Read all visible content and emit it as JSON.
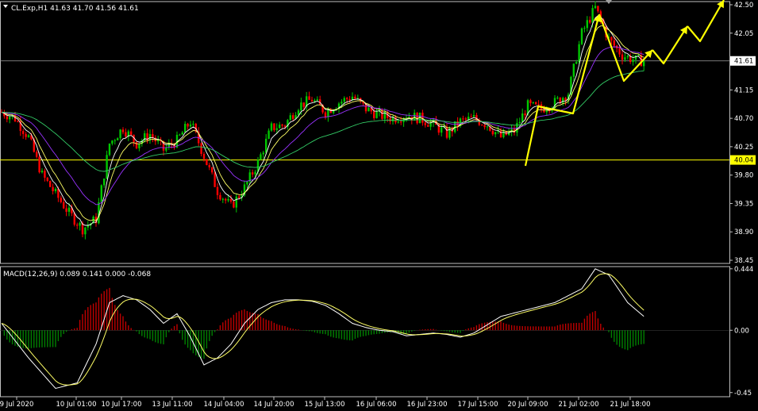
{
  "window": {
    "symbol_header": "CL.Exp,H1  41.63 41.70 41.56 41.61"
  },
  "price_panel": {
    "axis_ticks": [
      "42.50",
      "42.05",
      "41.61",
      "41.15",
      "40.70",
      "40.25",
      "40.04",
      "39.80",
      "39.35",
      "38.90",
      "38.45"
    ],
    "tick_values": [
      42.5,
      42.05,
      41.61,
      41.15,
      40.7,
      40.25,
      40.04,
      39.8,
      39.35,
      38.9,
      38.45
    ],
    "highlight_labels": {
      "current": "41.61",
      "horizontal_line": "40.04"
    },
    "current_price": 41.61,
    "horizontal_line_price": 40.04,
    "y_range": [
      38.4,
      42.55
    ]
  },
  "macd_panel": {
    "label": "MACD(12,26,9) 0.089 0.141 0.000 -0.068",
    "axis_ticks": [
      "0.444",
      "0.00",
      "-0.45"
    ],
    "tick_values": [
      0.444,
      0.0,
      -0.45
    ],
    "y_range": [
      -0.48,
      0.46
    ]
  },
  "time_axis": {
    "labels": [
      "9 Jul 2020",
      "10 Jul 01:00",
      "10 Jul 17:00",
      "13 Jul 11:00",
      "14 Jul 04:00",
      "14 Jul 20:00",
      "15 Jul 13:00",
      "16 Jul 06:00",
      "16 Jul 23:00",
      "17 Jul 15:00",
      "20 Jul 09:00",
      "21 Jul 02:00",
      "21 Jul 18:00"
    ]
  },
  "colors": {
    "background": "#000000",
    "bull_candle": "#00c800",
    "bear_candle": "#ff0000",
    "ma_fast": "#ffffff",
    "ma_yellow": "#ffff66",
    "ma_purple": "#9933ff",
    "ma_green": "#33cc66",
    "hline": "#ffff00",
    "macd_pos": "#c00000",
    "macd_neg": "#008000",
    "arrow": "#ffff00"
  },
  "chart_data": {
    "type": "candlestick",
    "title": "CL.Exp,H1",
    "price_anchors": [
      [
        0,
        40.8
      ],
      [
        5,
        40.7
      ],
      [
        10,
        40.4
      ],
      [
        15,
        39.8
      ],
      [
        20,
        39.5
      ],
      [
        25,
        39.2
      ],
      [
        30,
        38.95
      ],
      [
        35,
        39.1
      ],
      [
        40,
        40.3
      ],
      [
        45,
        40.55
      ],
      [
        50,
        40.3
      ],
      [
        55,
        40.45
      ],
      [
        60,
        40.2
      ],
      [
        65,
        40.35
      ],
      [
        70,
        40.65
      ],
      [
        75,
        40.1
      ],
      [
        80,
        39.55
      ],
      [
        85,
        39.3
      ],
      [
        90,
        39.6
      ],
      [
        95,
        40.0
      ],
      [
        100,
        40.55
      ],
      [
        105,
        40.6
      ],
      [
        110,
        40.9
      ],
      [
        115,
        41.0
      ],
      [
        120,
        40.8
      ],
      [
        125,
        40.95
      ],
      [
        130,
        41.05
      ],
      [
        135,
        40.85
      ],
      [
        140,
        40.75
      ],
      [
        145,
        40.7
      ],
      [
        150,
        40.75
      ],
      [
        155,
        40.7
      ],
      [
        160,
        40.6
      ],
      [
        165,
        40.45
      ],
      [
        170,
        40.65
      ],
      [
        175,
        40.7
      ],
      [
        180,
        40.6
      ],
      [
        185,
        40.4
      ],
      [
        190,
        40.5
      ],
      [
        195,
        40.9
      ],
      [
        200,
        40.85
      ],
      [
        205,
        40.95
      ],
      [
        210,
        41.1
      ],
      [
        215,
        42.05
      ],
      [
        220,
        42.45
      ],
      [
        225,
        41.95
      ],
      [
        230,
        41.7
      ],
      [
        235,
        41.62
      ],
      [
        238,
        41.61
      ]
    ],
    "macd_anchors": [
      [
        0,
        0.05
      ],
      [
        10,
        -0.2
      ],
      [
        20,
        -0.42
      ],
      [
        28,
        -0.38
      ],
      [
        35,
        -0.1
      ],
      [
        40,
        0.2
      ],
      [
        45,
        0.25
      ],
      [
        50,
        0.22
      ],
      [
        55,
        0.15
      ],
      [
        60,
        0.05
      ],
      [
        65,
        0.12
      ],
      [
        70,
        -0.05
      ],
      [
        75,
        -0.25
      ],
      [
        80,
        -0.2
      ],
      [
        85,
        -0.1
      ],
      [
        90,
        0.05
      ],
      [
        95,
        0.15
      ],
      [
        100,
        0.2
      ],
      [
        105,
        0.22
      ],
      [
        110,
        0.22
      ],
      [
        115,
        0.21
      ],
      [
        120,
        0.18
      ],
      [
        125,
        0.12
      ],
      [
        130,
        0.05
      ],
      [
        135,
        0.02
      ],
      [
        140,
        0.0
      ],
      [
        145,
        -0.01
      ],
      [
        150,
        -0.04
      ],
      [
        155,
        -0.03
      ],
      [
        160,
        -0.02
      ],
      [
        165,
        -0.03
      ],
      [
        170,
        -0.05
      ],
      [
        175,
        -0.02
      ],
      [
        185,
        0.1
      ],
      [
        195,
        0.15
      ],
      [
        205,
        0.2
      ],
      [
        215,
        0.3
      ],
      [
        220,
        0.444
      ],
      [
        225,
        0.4
      ],
      [
        232,
        0.2
      ],
      [
        238,
        0.1
      ]
    ],
    "forecast_arrows": [
      [
        [
          662,
          209
        ],
        [
          678,
          134
        ],
        [
          722,
          143
        ],
        [
          755,
          18
        ]
      ],
      [
        [
          755,
          18
        ],
        [
          786,
          102
        ],
        [
          822,
          63
        ]
      ],
      [
        [
          822,
          63
        ],
        [
          836,
          80
        ],
        [
          866,
          33
        ]
      ],
      [
        [
          866,
          33
        ],
        [
          882,
          52
        ],
        [
          912,
          0
        ]
      ]
    ]
  }
}
